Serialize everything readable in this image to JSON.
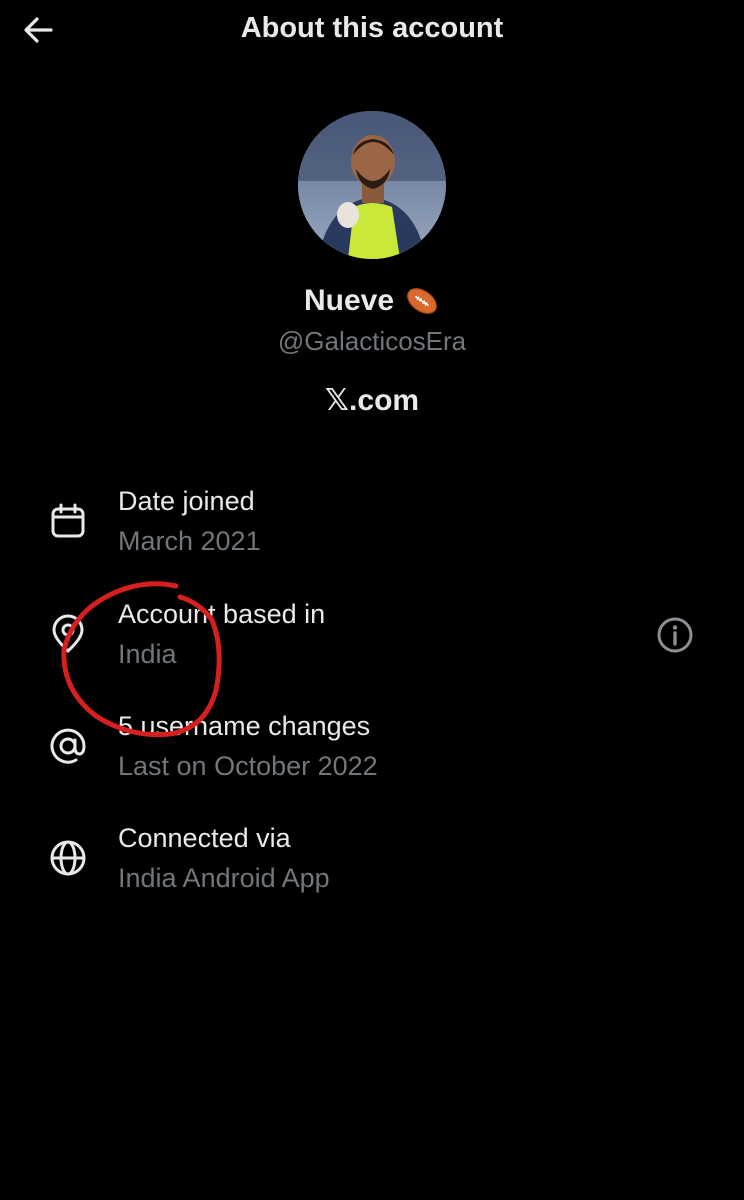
{
  "header": {
    "title": "About this account",
    "back_icon": "arrow-left-icon"
  },
  "profile": {
    "display_name": "Nueve",
    "name_emoji_icon": "football-ball-icon",
    "handle": "@GalacticosEra",
    "domain": "𝕏.com"
  },
  "details": [
    {
      "icon": "calendar-icon",
      "label": "Date joined",
      "value": "March 2021"
    },
    {
      "icon": "location-pin-icon",
      "label": "Account based in",
      "value": "India"
    },
    {
      "icon": "at-sign-icon",
      "label": "5 username changes",
      "value": "Last on October 2022"
    },
    {
      "icon": "globe-icon",
      "label": "Connected via",
      "value": "India Android App"
    }
  ],
  "info_icon": "info-circle-icon",
  "colors": {
    "background": "#000000",
    "primary_text": "#e7e9ea",
    "secondary_text": "#71767b",
    "annotation": "#d6201f"
  }
}
